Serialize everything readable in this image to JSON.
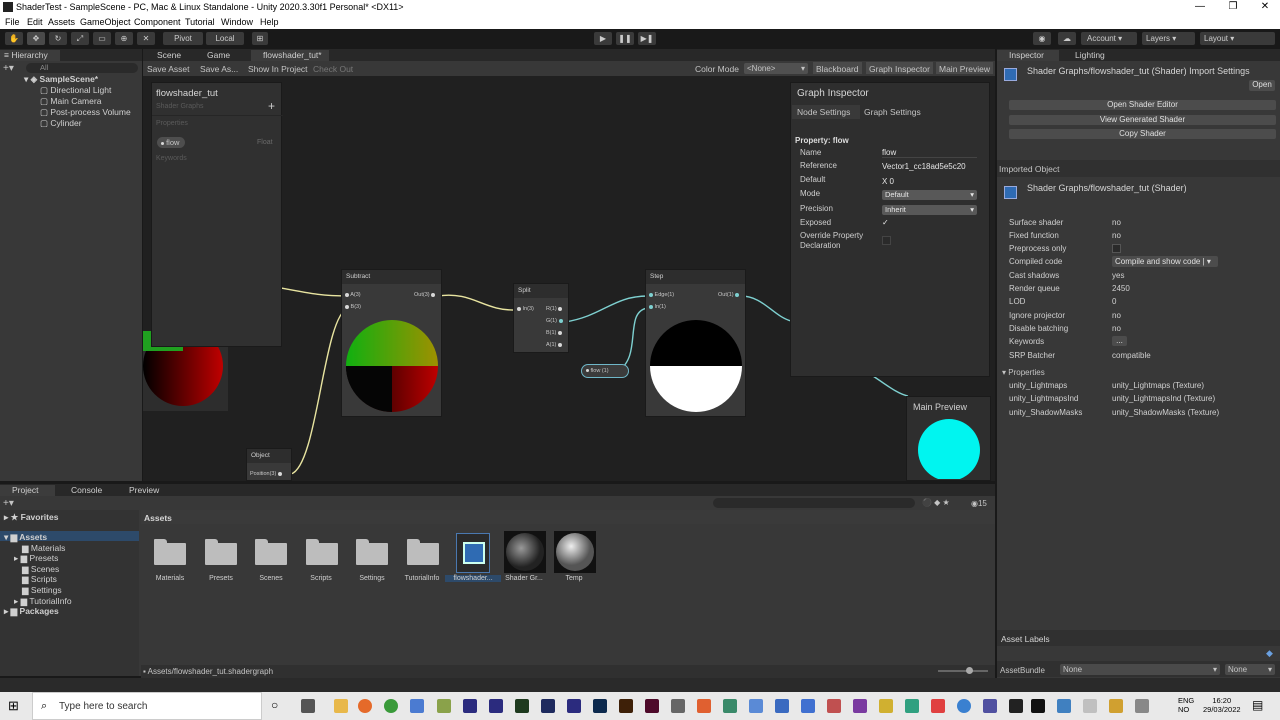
{
  "window": {
    "title": "ShaderTest - SampleScene - PC, Mac & Linux Standalone - Unity 2020.3.30f1 Personal* <DX11>"
  },
  "menu": [
    "File",
    "Edit",
    "Assets",
    "GameObject",
    "Component",
    "Tutorial",
    "Window",
    "Help"
  ],
  "toolbar": {
    "pivot": "Pivot",
    "local": "Local",
    "account": "Account",
    "layers": "Layers",
    "layout": "Layout"
  },
  "hierarchy": {
    "tab": "Hierarchy",
    "search": "All",
    "scene": "SampleScene*",
    "items": [
      "Directional Light",
      "Main Camera",
      "Post-process Volume",
      "Cylinder"
    ]
  },
  "scene_tabs": [
    "Scene",
    "Game",
    "flowshader_tut*"
  ],
  "graph_toolbar": {
    "save": "Save Asset",
    "save_as": "Save As...",
    "show": "Show In Project",
    "checkout": "Check Out",
    "color_mode": "Color Mode",
    "color_value": "<None>",
    "blackboard": "Blackboard",
    "graph_inspector": "Graph Inspector",
    "main_preview": "Main Preview"
  },
  "blackboard": {
    "title": "flowshader_tut",
    "subtitle": "Shader Graphs",
    "properties": "Properties",
    "prop_name": "flow",
    "prop_type": "Float",
    "keywords": "Keywords"
  },
  "nodes": {
    "subtract": {
      "title": "Subtract",
      "in_a": "A(3)",
      "in_b": "B(3)",
      "out": "Out(3)"
    },
    "split": {
      "title": "Split",
      "in": "In(3)",
      "r": "R(1)",
      "g": "G(1)",
      "b": "B(1)",
      "a": "A(1)"
    },
    "step": {
      "title": "Step",
      "edge": "Edge(1)",
      "in": "In(1)",
      "out": "Out(1)"
    },
    "object": {
      "title": "Object",
      "pos": "Position(3)"
    },
    "flow": {
      "label": "flow (1)"
    }
  },
  "graph_inspector": {
    "title": "Graph Inspector",
    "tab_node": "Node Settings",
    "tab_graph": "Graph Settings",
    "property": "Property: flow",
    "rows": [
      {
        "label": "Name",
        "value": "flow"
      },
      {
        "label": "Reference",
        "value": "Vector1_cc18ad5e5c20"
      },
      {
        "label": "Default",
        "value": "X  0"
      },
      {
        "label": "Mode",
        "value": "Default"
      },
      {
        "label": "Precision",
        "value": "Inherit"
      },
      {
        "label": "Exposed",
        "value": "✓"
      },
      {
        "label": "Override Property Declaration",
        "value": ""
      }
    ]
  },
  "main_preview": {
    "title": "Main Preview"
  },
  "inspector": {
    "tab": "Inspector",
    "tab2": "Lighting",
    "header": "Shader Graphs/flowshader_tut (Shader) Import Settings",
    "open": "Open",
    "buttons": [
      "Open Shader Editor",
      "View Generated Shader",
      "Copy Shader"
    ],
    "imported": "Imported Object",
    "header2": "Shader Graphs/flowshader_tut (Shader)",
    "rows": [
      {
        "label": "Surface shader",
        "value": "no"
      },
      {
        "label": "Fixed function",
        "value": "no"
      },
      {
        "label": "Preprocess only",
        "value": ""
      },
      {
        "label": "Compiled code",
        "value": "Compile and show code"
      },
      {
        "label": "Cast shadows",
        "value": "yes"
      },
      {
        "label": "Render queue",
        "value": "2450"
      },
      {
        "label": "LOD",
        "value": "0"
      },
      {
        "label": "Ignore projector",
        "value": "no"
      },
      {
        "label": "Disable batching",
        "value": "no"
      },
      {
        "label": "Keywords",
        "value": "..."
      },
      {
        "label": "SRP Batcher",
        "value": "compatible"
      }
    ],
    "properties": "Properties",
    "props": [
      {
        "label": "unity_Lightmaps",
        "value": "unity_Lightmaps (Texture)"
      },
      {
        "label": "unity_LightmapsInd",
        "value": "unity_LightmapsInd (Texture)"
      },
      {
        "label": "unity_ShadowMasks",
        "value": "unity_ShadowMasks (Texture)"
      }
    ],
    "asset_labels": "Asset Labels",
    "asset_bundle": "AssetBundle",
    "bundle_value": "None",
    "bundle_variant": "None"
  },
  "project": {
    "tabs": [
      "Project",
      "Console",
      "Preview"
    ],
    "favorites": "Favorites",
    "assets": "Assets",
    "tree": [
      "Materials",
      "Presets",
      "Scenes",
      "Scripts",
      "Settings",
      "TutorialInfo"
    ],
    "packages": "Packages",
    "breadcrumb": "Assets",
    "items": [
      "Materials",
      "Presets",
      "Scenes",
      "Scripts",
      "Settings",
      "TutorialInfo",
      "flowshader...",
      "Shader Gr...",
      "Temp"
    ],
    "count": "15",
    "path": "Assets/flowshader_tut.shadergraph"
  },
  "taskbar": {
    "search": "Type here to search",
    "lang1": "ENG",
    "lang2": "NO",
    "time": "16:20",
    "date": "29/03/2022"
  }
}
